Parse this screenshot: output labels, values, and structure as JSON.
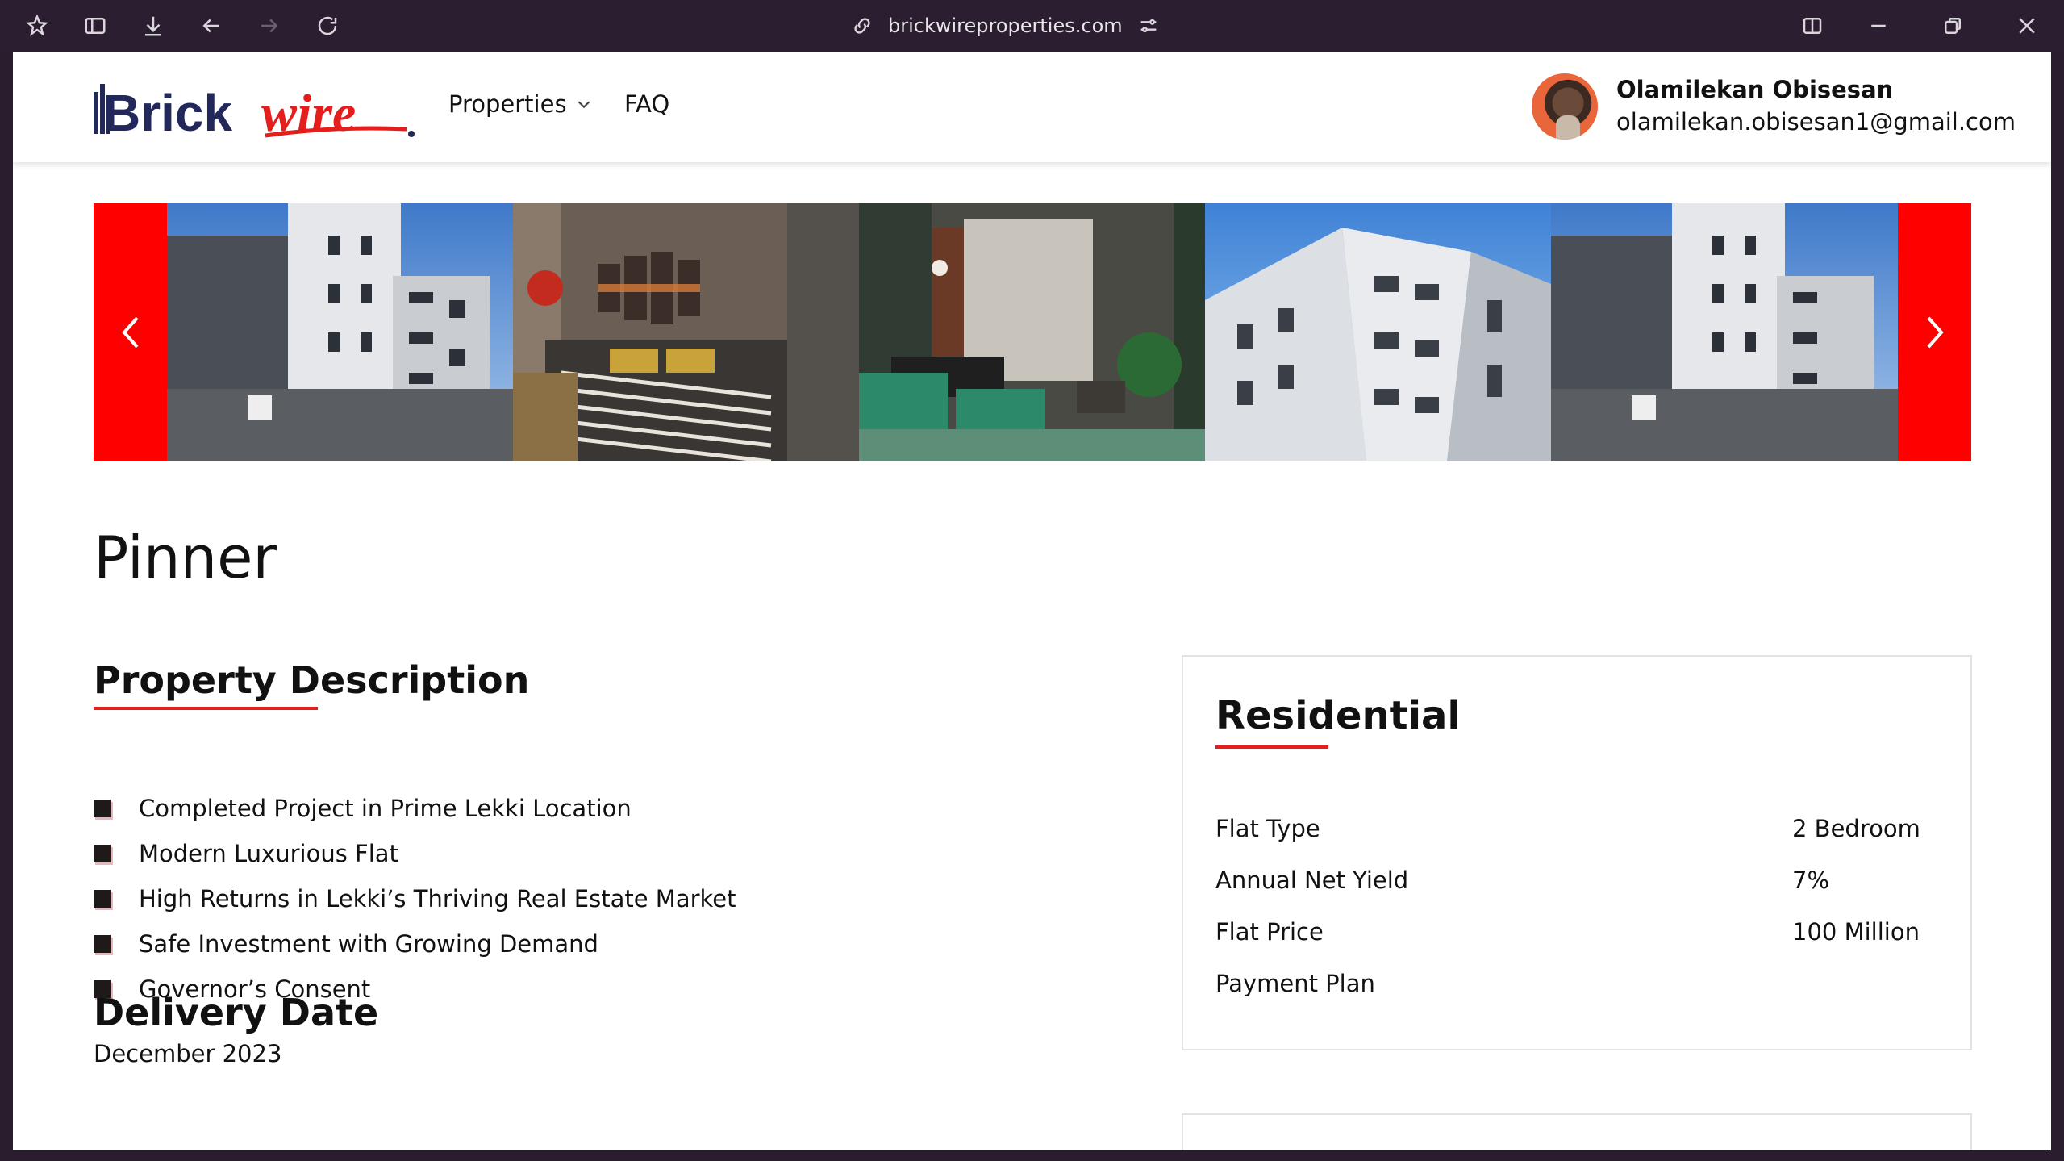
{
  "browser": {
    "url": "brickwireproperties.com"
  },
  "nav": {
    "logo_text": "Brickwire",
    "properties_label": "Properties",
    "faq_label": "FAQ"
  },
  "user": {
    "name": "Olamilekan Obisesan",
    "email": "olamilekan.obisesan1@gmail.com"
  },
  "carousel": {
    "slides": [
      "building-exterior",
      "bedroom-interior",
      "living-room-interior",
      "building-exterior-low-angle",
      "building-exterior"
    ]
  },
  "property": {
    "title": "Pinner",
    "description_heading": "Property Description",
    "bullets": [
      "Completed Project in Prime Lekki Location",
      "Modern Luxurious Flat",
      "High Returns in Lekki’s Thriving Real Estate Market",
      "Safe Investment with Growing Demand",
      "Governor’s Consent"
    ],
    "delivery_heading": "Delivery Date",
    "delivery_value": "December 2023"
  },
  "details_card": {
    "heading": "Residential",
    "rows": [
      {
        "label": "Flat Type",
        "value": "2 Bedroom"
      },
      {
        "label": "Annual Net Yield",
        "value": "7%"
      },
      {
        "label": "Flat Price",
        "value": "100 Million"
      },
      {
        "label": "Payment Plan",
        "value": ""
      }
    ]
  },
  "colors": {
    "brand_red": "#ff0000",
    "accent_underline": "#e41d1d",
    "chrome_bg": "#2b1e30"
  }
}
